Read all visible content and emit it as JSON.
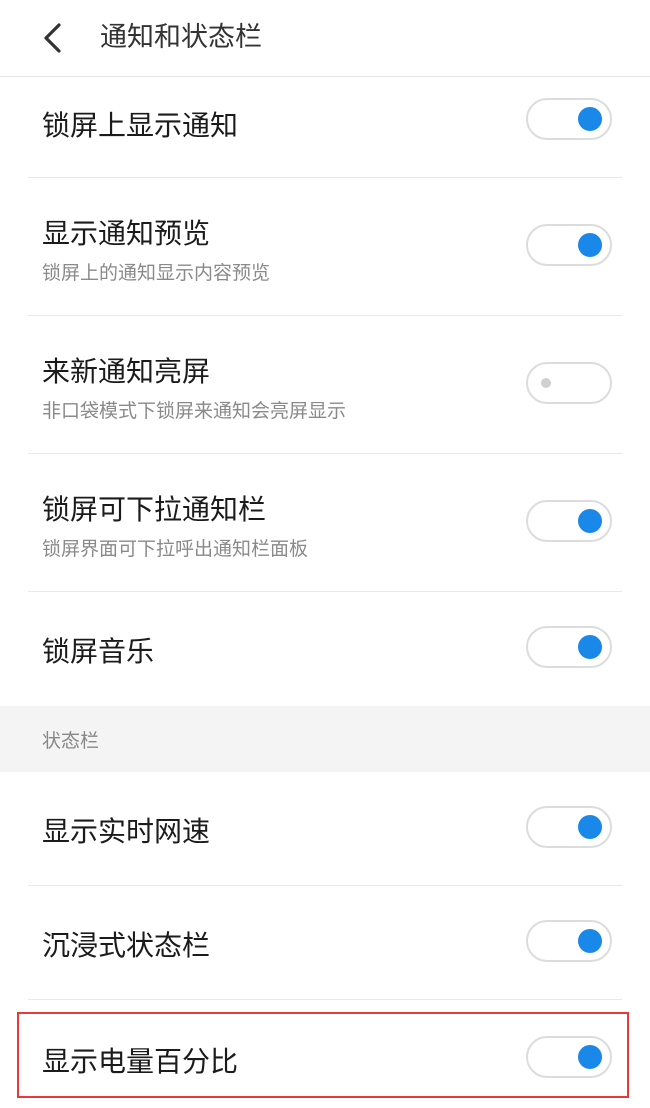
{
  "header": {
    "title": "通知和状态栏"
  },
  "notification_settings": [
    {
      "label": "锁屏上显示通知",
      "sublabel": "",
      "enabled": true
    },
    {
      "label": "显示通知预览",
      "sublabel": "锁屏上的通知显示内容预览",
      "enabled": true
    },
    {
      "label": "来新通知亮屏",
      "sublabel": "非口袋模式下锁屏来通知会亮屏显示",
      "enabled": false
    },
    {
      "label": "锁屏可下拉通知栏",
      "sublabel": "锁屏界面可下拉呼出通知栏面板",
      "enabled": true
    },
    {
      "label": "锁屏音乐",
      "sublabel": "",
      "enabled": true
    }
  ],
  "status_bar_section": {
    "title": "状态栏",
    "settings": [
      {
        "label": "显示实时网速",
        "enabled": true
      },
      {
        "label": "沉浸式状态栏",
        "enabled": true
      },
      {
        "label": "显示电量百分比",
        "enabled": true
      }
    ]
  },
  "colors": {
    "accent": "#1a88e8",
    "highlight_border": "#e83a3a",
    "section_bg": "#f4f4f4"
  }
}
